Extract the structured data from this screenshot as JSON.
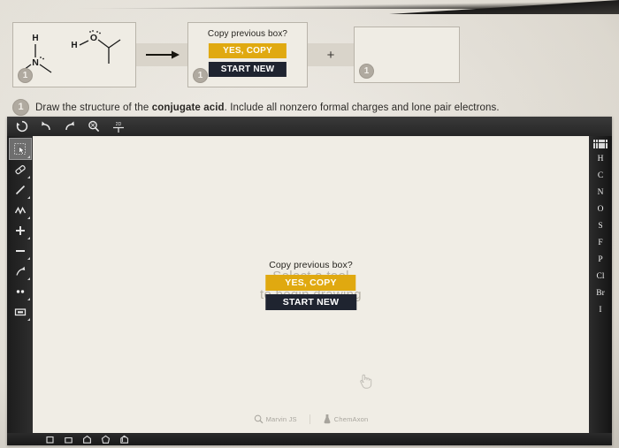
{
  "problem": {
    "instruction_prefix": "Draw the structure of the ",
    "instruction_bold": "conjugate acid",
    "instruction_suffix": ". Include all nonzero formal charges and lone pair electrons.",
    "badge_label": "1",
    "arrow_symbol": "→",
    "plus_symbol": "+",
    "reactant_box": {
      "badge": "1",
      "molecules": [
        {
          "name": "dimethylamine",
          "atom_labels": [
            "H",
            "N"
          ],
          "lone_pairs": 1
        },
        {
          "name": "isopropanol",
          "atom_labels": [
            "H",
            "O"
          ],
          "lone_pairs": 2
        }
      ]
    },
    "product_box_1": {
      "badge": "1",
      "content": ""
    },
    "product_box_2": {
      "badge": "1",
      "content": ""
    }
  },
  "copy_dialog": {
    "question": "Copy previous box?",
    "yes_label": "YES, COPY",
    "new_label": "START NEW",
    "yes_color": "#e0a910",
    "new_color": "#1f2430"
  },
  "editor": {
    "top_toolbar": [
      {
        "name": "reset-icon",
        "title": "Clear / Reset"
      },
      {
        "name": "undo-icon",
        "title": "Undo"
      },
      {
        "name": "redo-icon",
        "title": "Redo"
      },
      {
        "name": "zoom-icon",
        "title": "Zoom"
      },
      {
        "name": "clean-2d-icon",
        "title": "Clean 2D",
        "label": "2D"
      }
    ],
    "left_toolbar": [
      {
        "name": "select-tool",
        "title": "Selection",
        "selected": true
      },
      {
        "name": "eraser-tool",
        "title": "Eraser",
        "selected": false
      },
      {
        "name": "bond-tool",
        "title": "Single bond",
        "selected": false
      },
      {
        "name": "chain-tool",
        "title": "Chain",
        "selected": false
      },
      {
        "name": "plus-charge-tool",
        "title": "Increase charge",
        "selected": false,
        "label": "+"
      },
      {
        "name": "minus-charge-tool",
        "title": "Decrease charge",
        "selected": false,
        "label": "−"
      },
      {
        "name": "arrow-tool",
        "title": "Arrow",
        "selected": false
      },
      {
        "name": "lone-pair-tool",
        "title": "Lone pair",
        "selected": false
      },
      {
        "name": "rectangle-tool",
        "title": "Rectangle",
        "selected": false
      }
    ],
    "right_toolbar": {
      "periodic_table_title": "Periodic table",
      "elements": [
        "H",
        "C",
        "N",
        "O",
        "S",
        "F",
        "P",
        "Cl",
        "Br",
        "I"
      ]
    },
    "bottom_toolbar": [
      {
        "name": "cyclobutane-template",
        "title": "Cyclobutane"
      },
      {
        "name": "cyclopentane-template",
        "title": "Cyclopentane"
      },
      {
        "name": "cyclohexane-template",
        "title": "Cyclohexane"
      },
      {
        "name": "cycloheptane-template",
        "title": "Cycloheptane"
      },
      {
        "name": "benzene-template",
        "title": "Benzene"
      }
    ],
    "canvas": {
      "hint_line_1": "Select a tool",
      "hint_line_2": "to begin drawing",
      "brand_marvin": "Marvin JS",
      "brand_chemaxon": "ChemAxon"
    }
  }
}
